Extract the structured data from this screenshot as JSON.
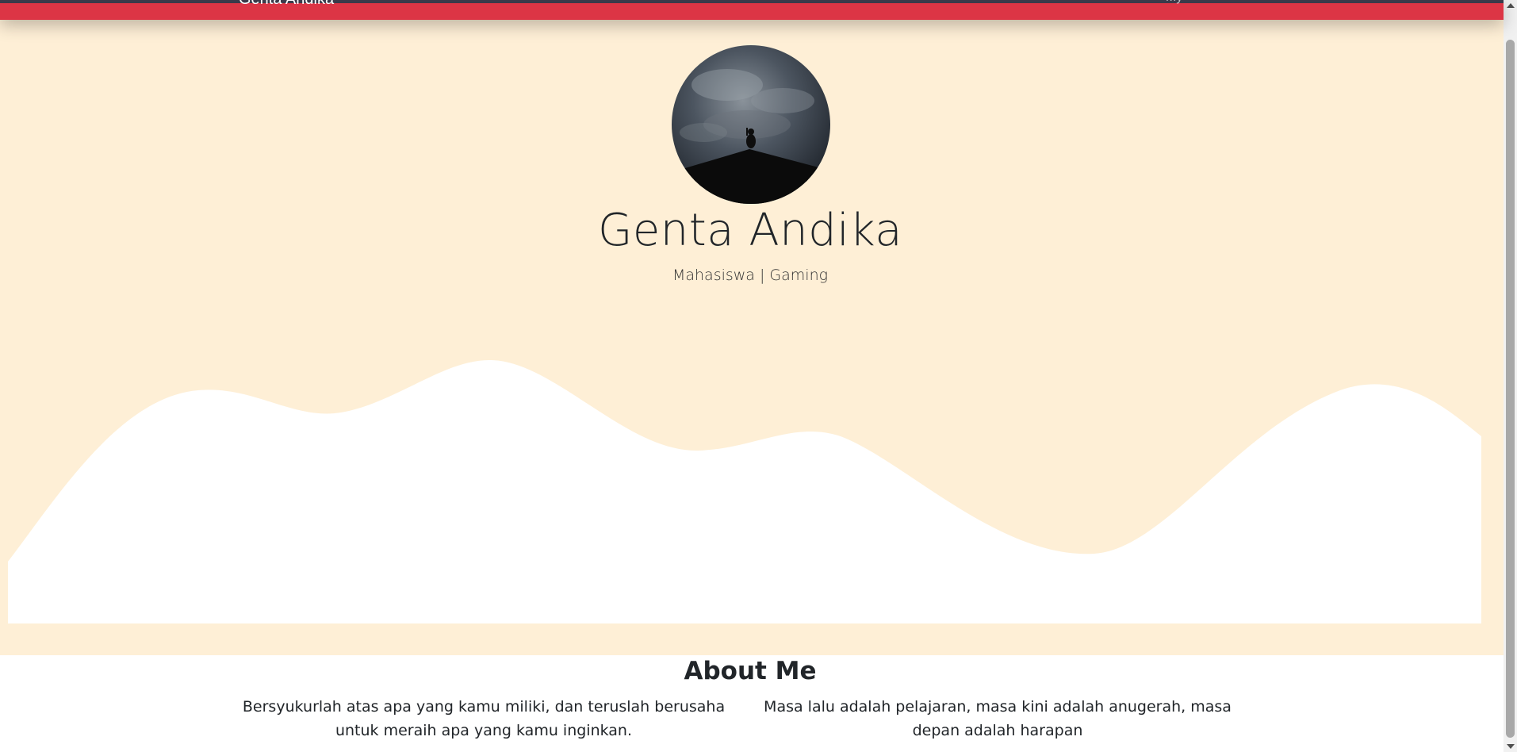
{
  "navbar": {
    "brand": "Genta Andika",
    "link": "My",
    "color": "#dc3545"
  },
  "hero": {
    "name": "Genta Andika",
    "subtitle": "Mahasiswa | Gaming",
    "background": "#feefd6",
    "avatar_alt": "profile photo of person sitting on a rooftop under a cloudy sky"
  },
  "about": {
    "heading": "About Me",
    "paragraph_left": "Bersyukurlah atas apa yang kamu miliki, dan teruslah berusaha untuk meraih apa yang kamu inginkan.",
    "paragraph_right": "Masa lalu adalah pelajaran, masa kini adalah anugerah, masa depan adalah harapan"
  }
}
